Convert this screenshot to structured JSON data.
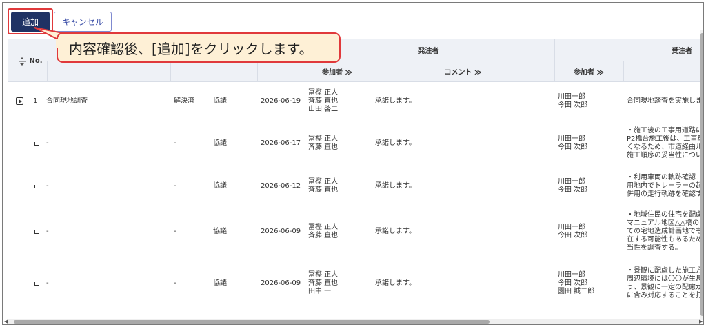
{
  "toolbar": {
    "add_label": "追加",
    "cancel_label": "キャンセル"
  },
  "callout": {
    "text": "内容確認後、[追加]をクリックします。"
  },
  "table": {
    "header_no": "No.",
    "header_orderer": "発注者",
    "header_contractor": "受注者",
    "sub_participants": "参加者 ≫",
    "sub_comment": "コメント ≫",
    "sub_participants2": "参加者 ≫",
    "rows": [
      {
        "no": "1",
        "title": "合同現地調査",
        "status": "解決済",
        "type": "協議",
        "date": "2026-06-19",
        "orderer_participants": [
          "冨樫 正人",
          "斉藤 直也",
          "山田 啓二"
        ],
        "orderer_comment": "承諾します。",
        "contractor_participants": [
          "川田一郎",
          "今田 次郎"
        ],
        "contractor_comment": [
          "合同現地踏査を実施しま"
        ]
      },
      {
        "no": "",
        "title": "-",
        "status": "-",
        "type": "協議",
        "date": "2026-06-17",
        "orderer_participants": [
          "冨樫 正人",
          "斉藤 直也"
        ],
        "orderer_comment": "承諾します。",
        "contractor_participants": [
          "川田一郎",
          "今田 次郎"
        ],
        "contractor_comment": [
          "・施工後の工事用道路に",
          "P2橋台施工後は、工事車",
          "くなるため、市道経由ル",
          "施工順序の妥当性につい"
        ]
      },
      {
        "no": "",
        "title": "-",
        "status": "-",
        "type": "協議",
        "date": "2026-06-12",
        "orderer_participants": [
          "冨樫 正人",
          "斉藤 直也"
        ],
        "orderer_comment": "承諾します。",
        "contractor_participants": [
          "川田一郎",
          "今田 次郎"
        ],
        "contractor_comment": [
          "・利用車両の軌跡確認",
          "用地内でトレーラーの起",
          "併用の走行軌跡を確認す"
        ]
      },
      {
        "no": "",
        "title": "-",
        "status": "-",
        "type": "協議",
        "date": "2026-06-09",
        "orderer_participants": [
          "冨樫 正人",
          "斉藤 直也"
        ],
        "orderer_comment": "承諾します。",
        "contractor_participants": [
          "川田一郎",
          "今田 次郎"
        ],
        "contractor_comment": [
          "・地域住民の住宅を配慮",
          "マニュアル地区△△橋の",
          "ての宅地造成計画地でも",
          "在する可能性もあるため",
          "当性を調査する。"
        ]
      },
      {
        "no": "",
        "title": "-",
        "status": "-",
        "type": "協議",
        "date": "2026-06-09",
        "orderer_participants": [
          "冨樫 正人",
          "斉藤 直也",
          "田中 一"
        ],
        "orderer_comment": "承諾します。",
        "contractor_participants": [
          "川田一郎",
          "今田 次郎",
          "園田 誠二郎"
        ],
        "contractor_comment": [
          "・景観に配慮した施工方",
          "周辺環境には〇〇が生息",
          "う、景観に一定の配慮が",
          "に含み対応することを打"
        ]
      }
    ]
  },
  "colors": {
    "primary": "#1f3264",
    "highlight": "#e0393b",
    "callout_bg": "#fef0d6",
    "header_bg": "#eef1f6"
  },
  "icons": {
    "sort": "sort-icon",
    "expand": "expand-caret-icon",
    "child": "child-row-icon"
  }
}
